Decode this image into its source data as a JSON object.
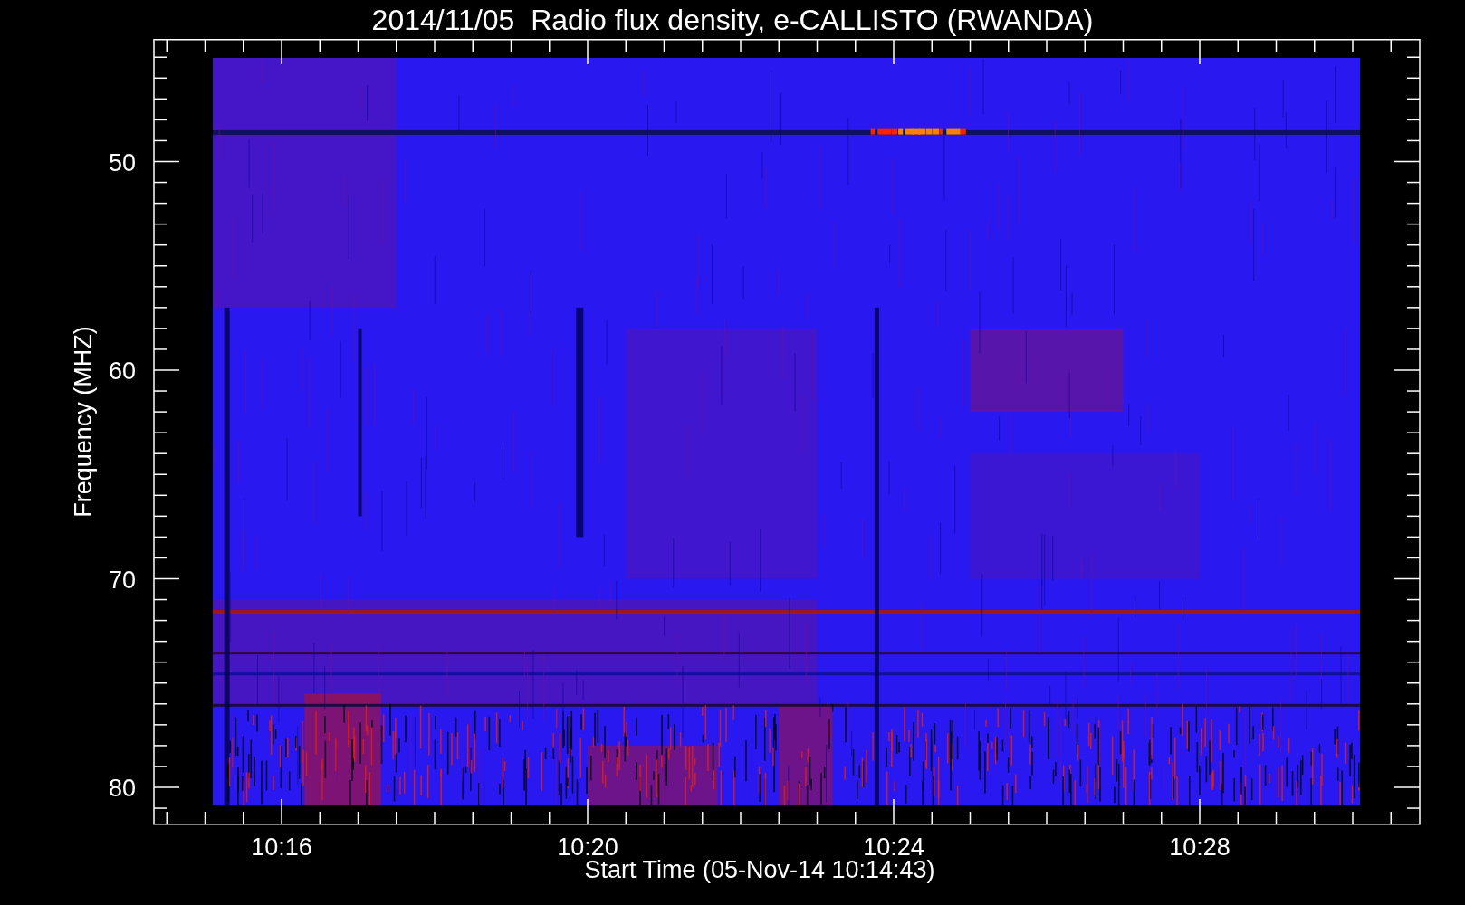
{
  "title": "2014/11/05  Radio flux density, e-CALLISTO (RWANDA)",
  "y_axis": {
    "label": "Frequency (MHZ)",
    "ticks": [
      "50",
      "60",
      "70",
      "80"
    ]
  },
  "x_axis": {
    "label": "Start Time (05-Nov-14 10:14:43)",
    "ticks": [
      "10:16",
      "10:20",
      "10:24",
      "10:28"
    ]
  }
}
